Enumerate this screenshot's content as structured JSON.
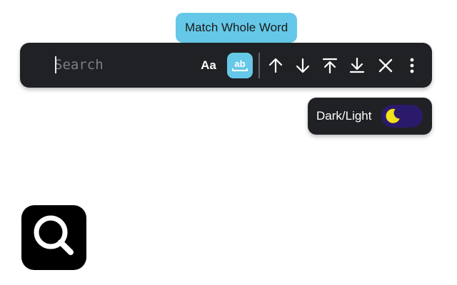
{
  "tooltip": {
    "text": "Match Whole Word"
  },
  "findbar": {
    "search_placeholder": "Search",
    "search_value": "",
    "match_case_label": "Aa",
    "whole_word_icon": "whole-word-icon",
    "whole_word_active": true,
    "buttons": [
      {
        "name": "previous-match",
        "icon": "arrow-up-icon"
      },
      {
        "name": "next-match",
        "icon": "arrow-down-icon"
      },
      {
        "name": "first-match",
        "icon": "arrow-to-top-icon"
      },
      {
        "name": "last-match",
        "icon": "arrow-to-bottom-icon"
      },
      {
        "name": "close",
        "icon": "close-icon"
      },
      {
        "name": "more-options",
        "icon": "more-vertical-icon"
      }
    ]
  },
  "theme_toggle": {
    "label": "Dark/Light",
    "mode": "dark",
    "icon": "moon-icon"
  },
  "app_icon": {
    "icon": "search-icon"
  },
  "colors": {
    "bar_background": "#202124",
    "accent": "#66c8e8",
    "switch_track": "#2b1a6b",
    "moon": "#f2e21a",
    "icon_foreground": "#ffffff",
    "app_icon_background": "#000000"
  }
}
